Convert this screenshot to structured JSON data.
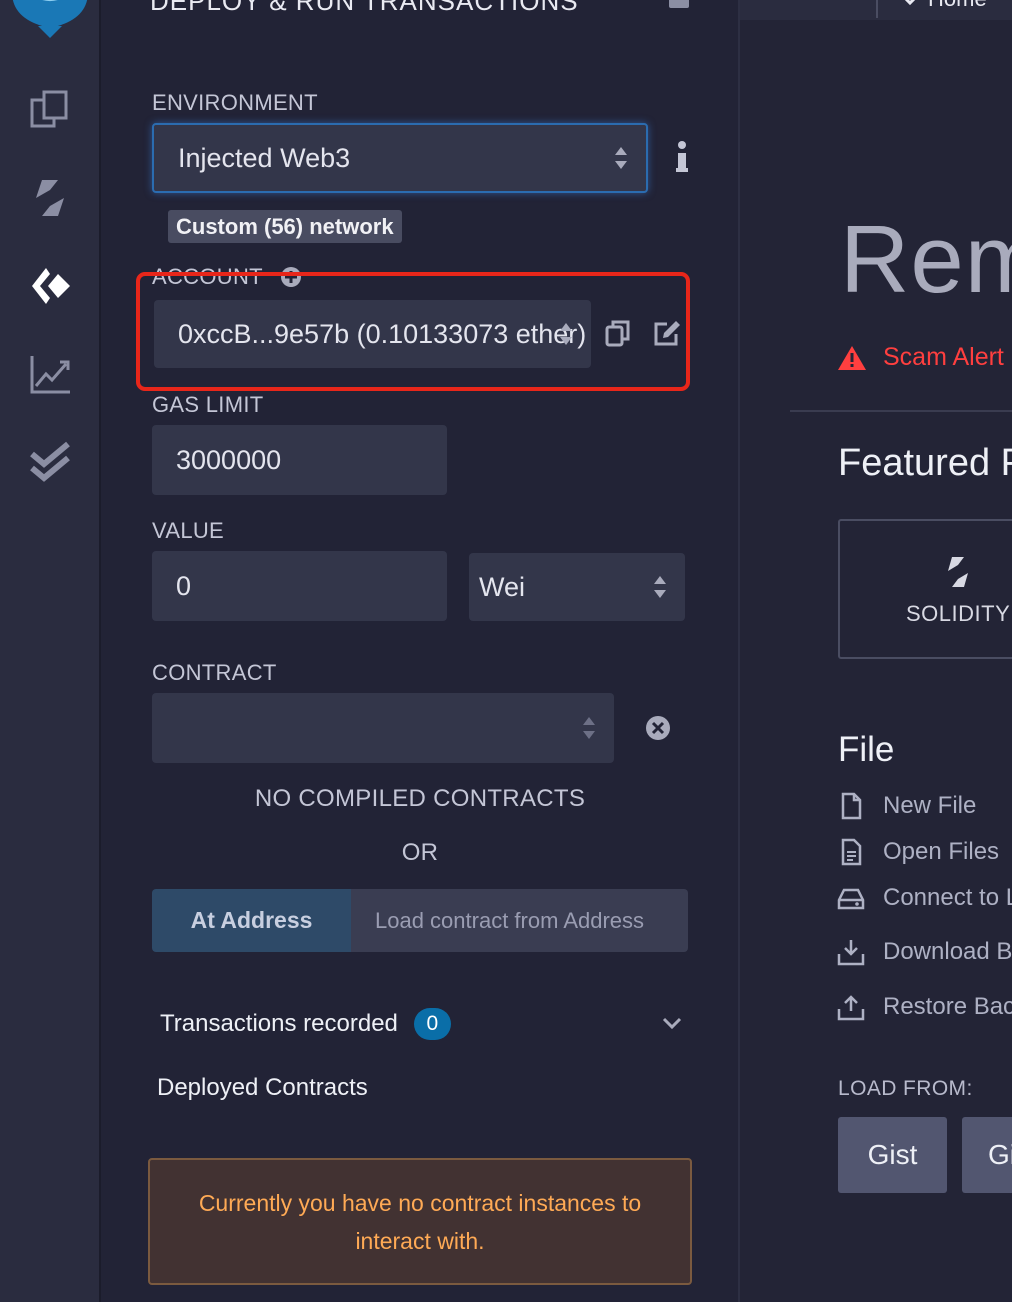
{
  "panel": {
    "title": "DEPLOY & RUN TRANSACTIONS",
    "environment": {
      "label": "ENVIRONMENT",
      "selected": "Injected Web3",
      "network_badge": "Custom (56) network"
    },
    "account": {
      "label": "ACCOUNT",
      "selected": "0xccB...9e57b (0.10133073 ether)"
    },
    "gas_limit": {
      "label": "GAS LIMIT",
      "value": "3000000"
    },
    "value": {
      "label": "VALUE",
      "amount": "0",
      "unit": "Wei"
    },
    "contract": {
      "label": "CONTRACT",
      "selected": "",
      "no_compiled": "NO COMPILED CONTRACTS",
      "or": "OR"
    },
    "at_address": {
      "button_label": "At Address",
      "placeholder": "Load contract from Address"
    },
    "transactions": {
      "label": "Transactions recorded",
      "count": "0"
    },
    "deployed": {
      "label": "Deployed Contracts",
      "empty_message": "Currently you have no contract instances to interact with."
    }
  },
  "main": {
    "home_tab": "Home",
    "hero_title": "Remix",
    "scam_alert": "Scam Alert",
    "featured_title": "Featured Plugins",
    "featured_card_label": "SOLIDITY",
    "file_section_title": "File",
    "file_items": [
      {
        "label": "New File",
        "icon": "file-icon"
      },
      {
        "label": "Open Files",
        "icon": "file-text-icon"
      },
      {
        "label": "Connect to Localhost",
        "icon": "hard-drive-icon"
      },
      {
        "label": "Download Backup",
        "icon": "download-icon"
      },
      {
        "label": "Restore Backup",
        "icon": "upload-icon"
      }
    ],
    "load_from_label": "LOAD FROM:",
    "load_buttons": [
      "Gist",
      "GitHub"
    ]
  },
  "colors": {
    "accent_blue": "#0a6ea8",
    "highlight_red": "#e8261a",
    "warning_text": "#ffaa55",
    "scam_red": "#ff3f3f"
  }
}
